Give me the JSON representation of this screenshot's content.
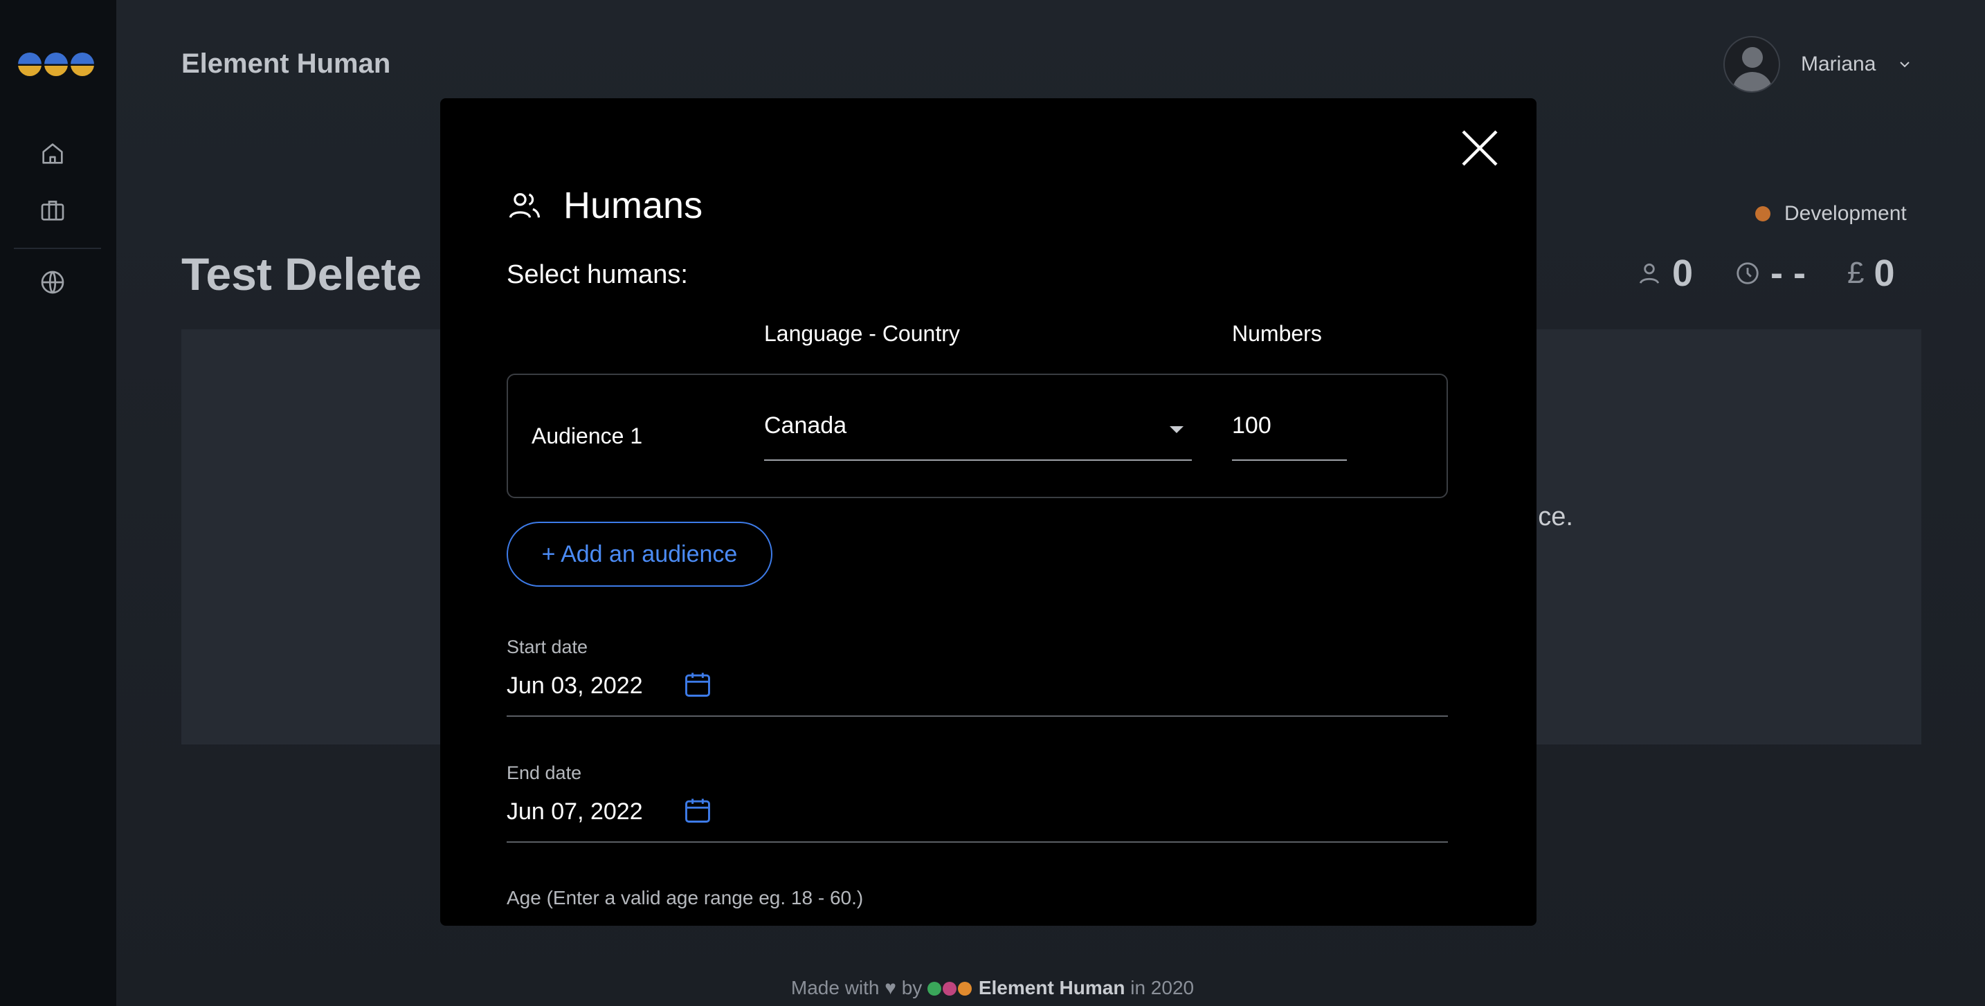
{
  "app": {
    "title": "Element Human",
    "user_name": "Mariana",
    "environment": "Development"
  },
  "page": {
    "title": "Test Delete",
    "stats": {
      "humans": "0",
      "time": "- -",
      "currency_symbol": "£",
      "cost": "0"
    },
    "background_text": "ence."
  },
  "sidebar": {
    "icons": [
      "home-icon",
      "briefcase-icon",
      "globe-icon"
    ]
  },
  "modal": {
    "title": "Humans",
    "select_label": "Select humans:",
    "col_language_country": "Language - Country",
    "col_numbers": "Numbers",
    "audience": {
      "name": "Audience 1",
      "country": "Canada",
      "number": "100"
    },
    "add_audience": "+ Add an audience",
    "start_date_label": "Start date",
    "start_date": "Jun 03, 2022",
    "end_date_label": "End date",
    "end_date": "Jun 07, 2022",
    "age_label": "Age (Enter a valid age range eg. 18 - 60.)"
  },
  "footer": {
    "made_with": "Made with",
    "by": "by",
    "brand": "Element Human",
    "year_text": "in 2020"
  },
  "colors": {
    "accent": "#3d7be8",
    "env_dot": "#c4702e",
    "modal_bg": "#000000"
  }
}
